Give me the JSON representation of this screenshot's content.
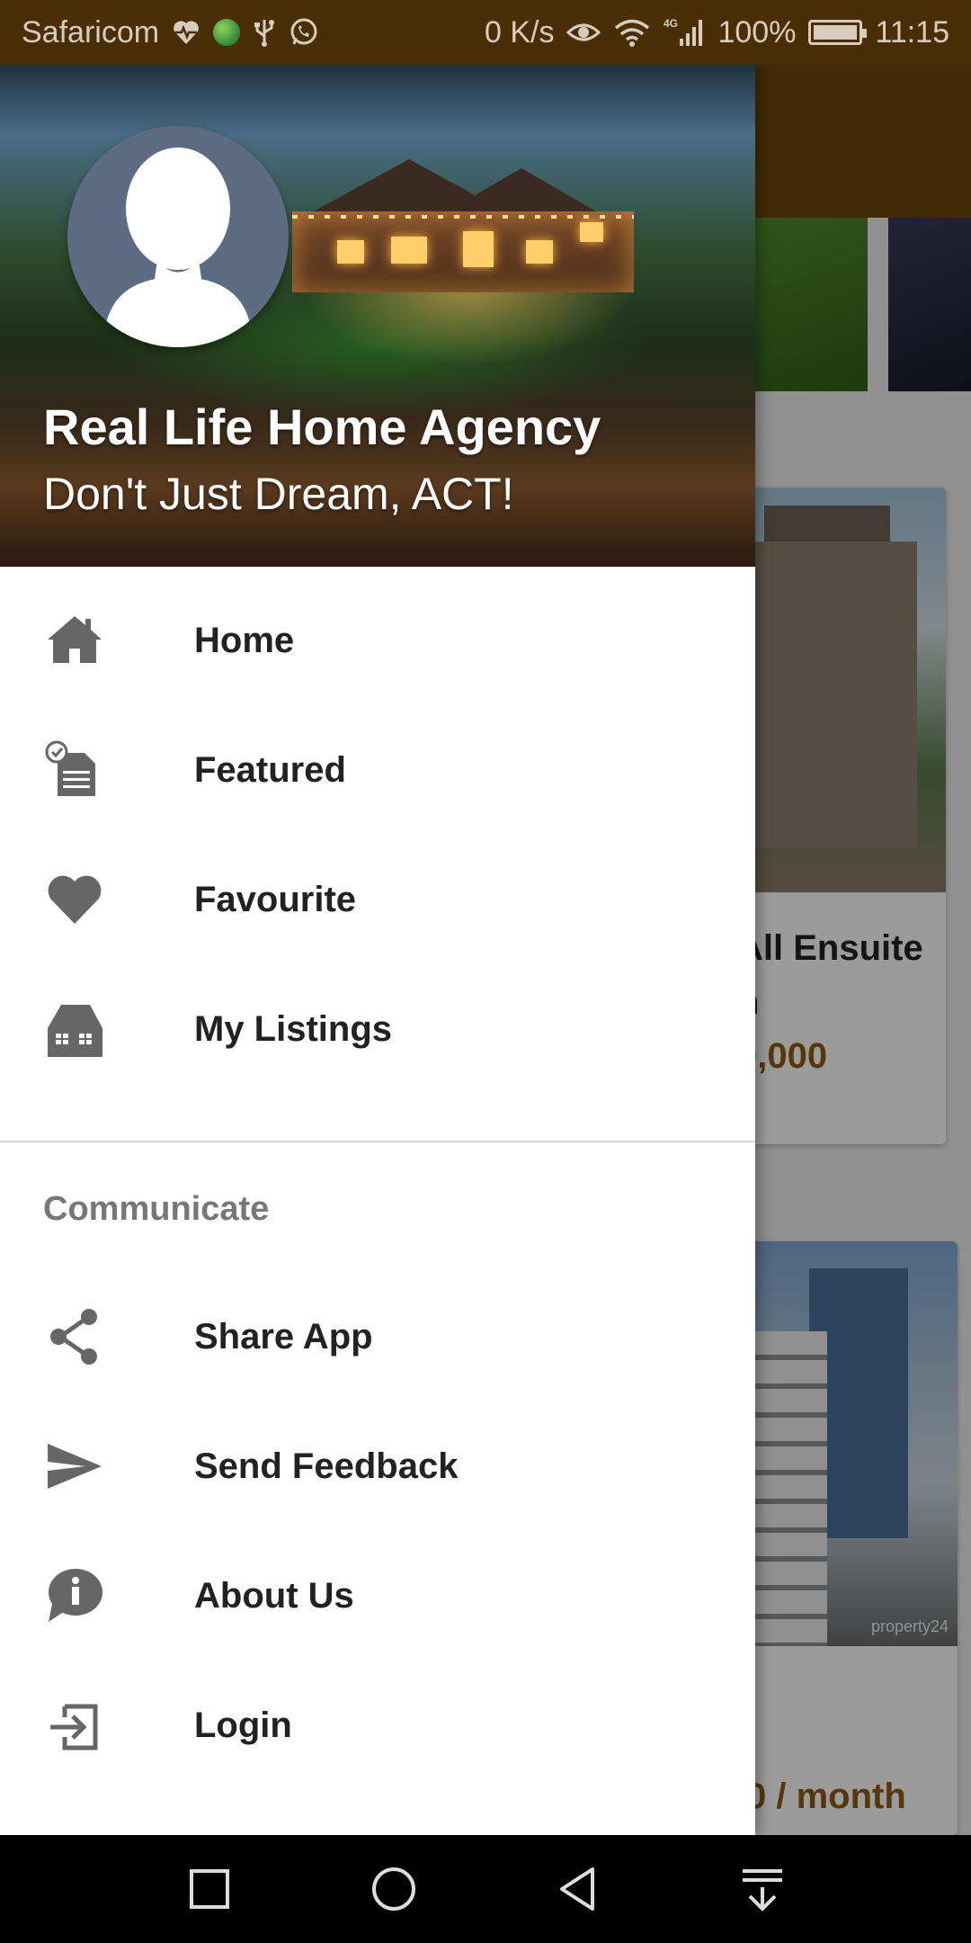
{
  "status_bar": {
    "carrier": "Safaricom",
    "net_speed": "0 K/s",
    "network_type": "4G",
    "battery": "100%",
    "battery_level": 1.0,
    "time": "11:15",
    "icons": [
      "heart-pulse-icon",
      "globe-icon",
      "usb-icon",
      "whatsapp-icon",
      "eye-icon",
      "wifi-icon",
      "signal-icon",
      "battery-icon"
    ]
  },
  "drawer": {
    "header": {
      "title": "Real Life Home Agency",
      "tagline": "Don't Just Dream, ACT!"
    },
    "primary_items": [
      {
        "label": "Home",
        "icon": "home-icon"
      },
      {
        "label": "Featured",
        "icon": "featured-icon"
      },
      {
        "label": "Favourite",
        "icon": "heart-icon"
      },
      {
        "label": "My Listings",
        "icon": "building-icon"
      }
    ],
    "section_title": "Communicate",
    "secondary_items": [
      {
        "label": "Share App",
        "icon": "share-icon"
      },
      {
        "label": "Send Feedback",
        "icon": "send-icon"
      },
      {
        "label": "About Us",
        "icon": "info-icon"
      },
      {
        "label": "Login",
        "icon": "login-icon"
      }
    ]
  },
  "background_content": {
    "card1_title_line1": "All Ensuite",
    "card1_title_line2": "n",
    "card1_price": "0,000",
    "card2_price": "0 / month",
    "card2_watermark": "property24"
  },
  "nav_bar": {
    "buttons": [
      "recents-button",
      "home-button",
      "back-button",
      "notification-pull-button"
    ]
  },
  "colors": {
    "status_bar": "#4a2e05",
    "toolbar": "#6b4409",
    "price_accent": "#8a5a10",
    "icon_gray": "#666666"
  }
}
